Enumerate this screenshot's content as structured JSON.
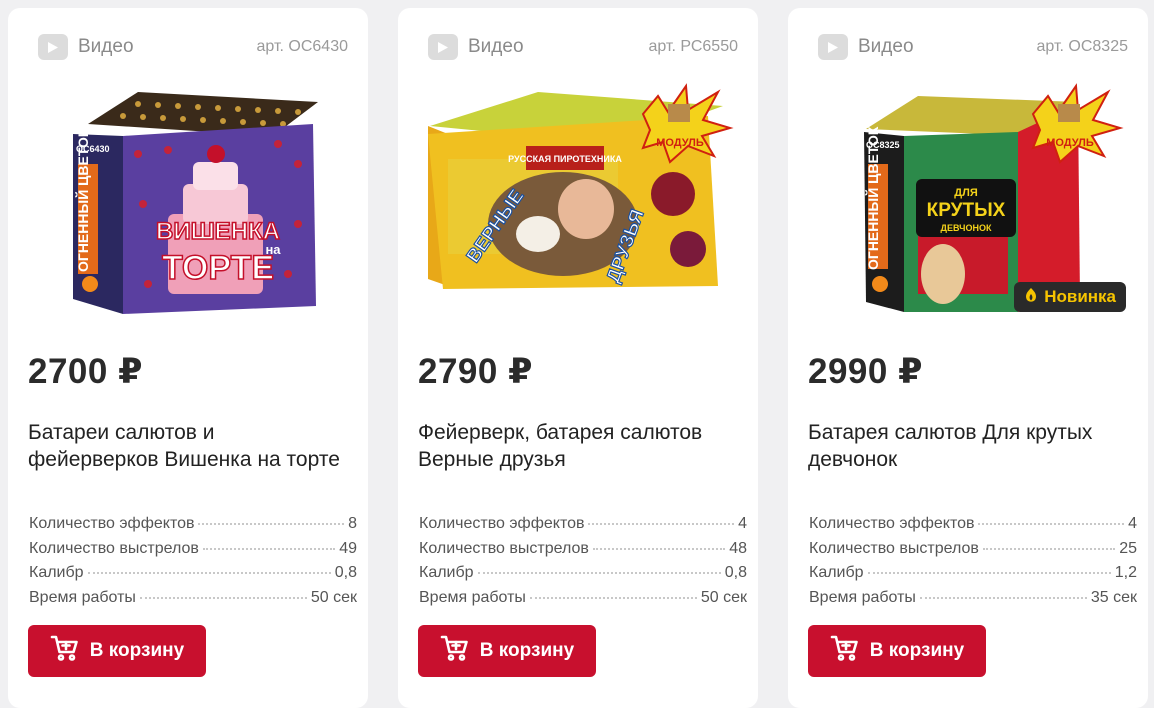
{
  "cards": [
    {
      "video_label": "Видео",
      "article": "арт. ОС6430",
      "price": "2700 ₽",
      "title": "Батареи салютов и фейерверков Вишенка на торте",
      "specs": [
        {
          "label": "Количество эффектов",
          "value": "8"
        },
        {
          "label": "Количество выстрелов",
          "value": "49"
        },
        {
          "label": "Калибр",
          "value": "0,8"
        },
        {
          "label": "Время работы",
          "value": "50 сек"
        }
      ],
      "button_label": "В корзину",
      "image_text": {
        "box_code": "ОС6430",
        "brand": "ОГНЕННЫЙ ЦВЕТОК",
        "line1": "ВИШЕНКА",
        "line2": "на",
        "line3": "ТОРТЕ"
      }
    },
    {
      "video_label": "Видео",
      "article": "арт. РС6550",
      "price": "2790 ₽",
      "title": "Фейерверк, батарея салютов Верные друзья",
      "specs": [
        {
          "label": "Количество эффектов",
          "value": "4"
        },
        {
          "label": "Количество выстрелов",
          "value": "48"
        },
        {
          "label": "Калибр",
          "value": "0,8"
        },
        {
          "label": "Время работы",
          "value": "50 сек"
        }
      ],
      "button_label": "В корзину",
      "image_text": {
        "module": "МОДУЛЬ",
        "brand": "РУССКАЯ ПИРОТЕХНИКА",
        "left": "ВЕРНЫЕ",
        "right": "ДРУЗЬЯ"
      }
    },
    {
      "video_label": "Видео",
      "article": "арт. ОС8325",
      "price": "2990 ₽",
      "title": "Батарея салютов Для крутых девчонок",
      "specs": [
        {
          "label": "Количество эффектов",
          "value": "4"
        },
        {
          "label": "Количество выстрелов",
          "value": "25"
        },
        {
          "label": "Калибр",
          "value": "1,2"
        },
        {
          "label": "Время работы",
          "value": "35 сек"
        }
      ],
      "button_label": "В корзину",
      "badge": "Новинка",
      "image_text": {
        "module": "МОДУЛЬ",
        "box_code": "ОС8325",
        "brand": "ОГНЕННЫЙ ЦВЕТОК",
        "line1": "ДЛЯ",
        "line2": "КРУТЫХ",
        "line3": "ДЕВЧОНОК"
      }
    }
  ],
  "colors": {
    "accent": "#c8102e",
    "badge_bg": "#2a2a2a",
    "badge_text": "#f6c400"
  }
}
